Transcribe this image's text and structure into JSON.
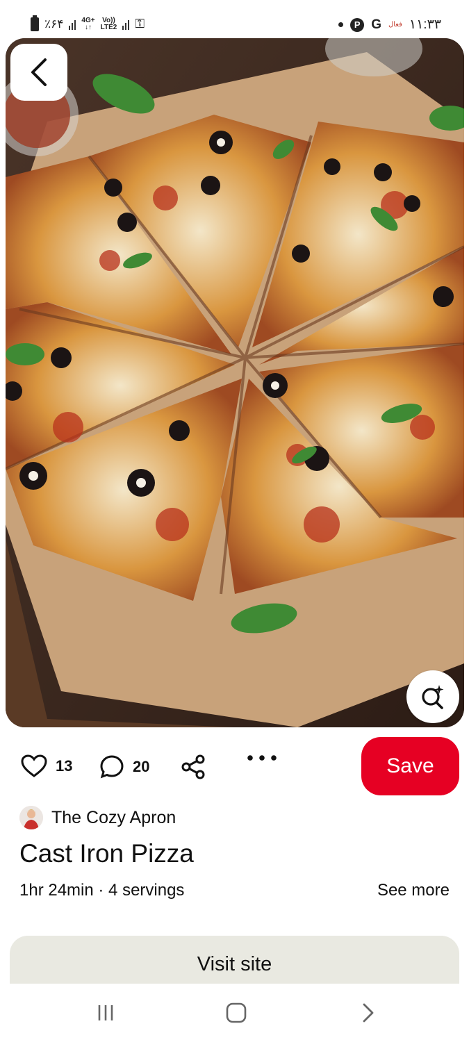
{
  "status_bar": {
    "battery": "٪۶۴",
    "network_type": "4G+",
    "volte": "Vo))",
    "lte": "LTE2",
    "carrier_label": "فعال",
    "time": "۱۱:۳۳",
    "icons": [
      "battery-icon",
      "signal-icon",
      "key-icon",
      "dot-icon",
      "pinterest-icon",
      "google-icon"
    ]
  },
  "pin": {
    "image_alt": "Cast Iron Pizza photo",
    "likes": "13",
    "comments": "20",
    "save_label": "Save",
    "creator": "The Cozy Apron",
    "title": "Cast Iron Pizza",
    "meta": "1hr 24min · 4 servings",
    "see_more": "See more",
    "visit_label": "Visit site"
  },
  "colors": {
    "save": "#e60023",
    "visit_bg": "#e9e9e1"
  },
  "nav": {
    "icons": [
      "recent-apps-icon",
      "home-icon",
      "back-chevron-icon"
    ]
  }
}
